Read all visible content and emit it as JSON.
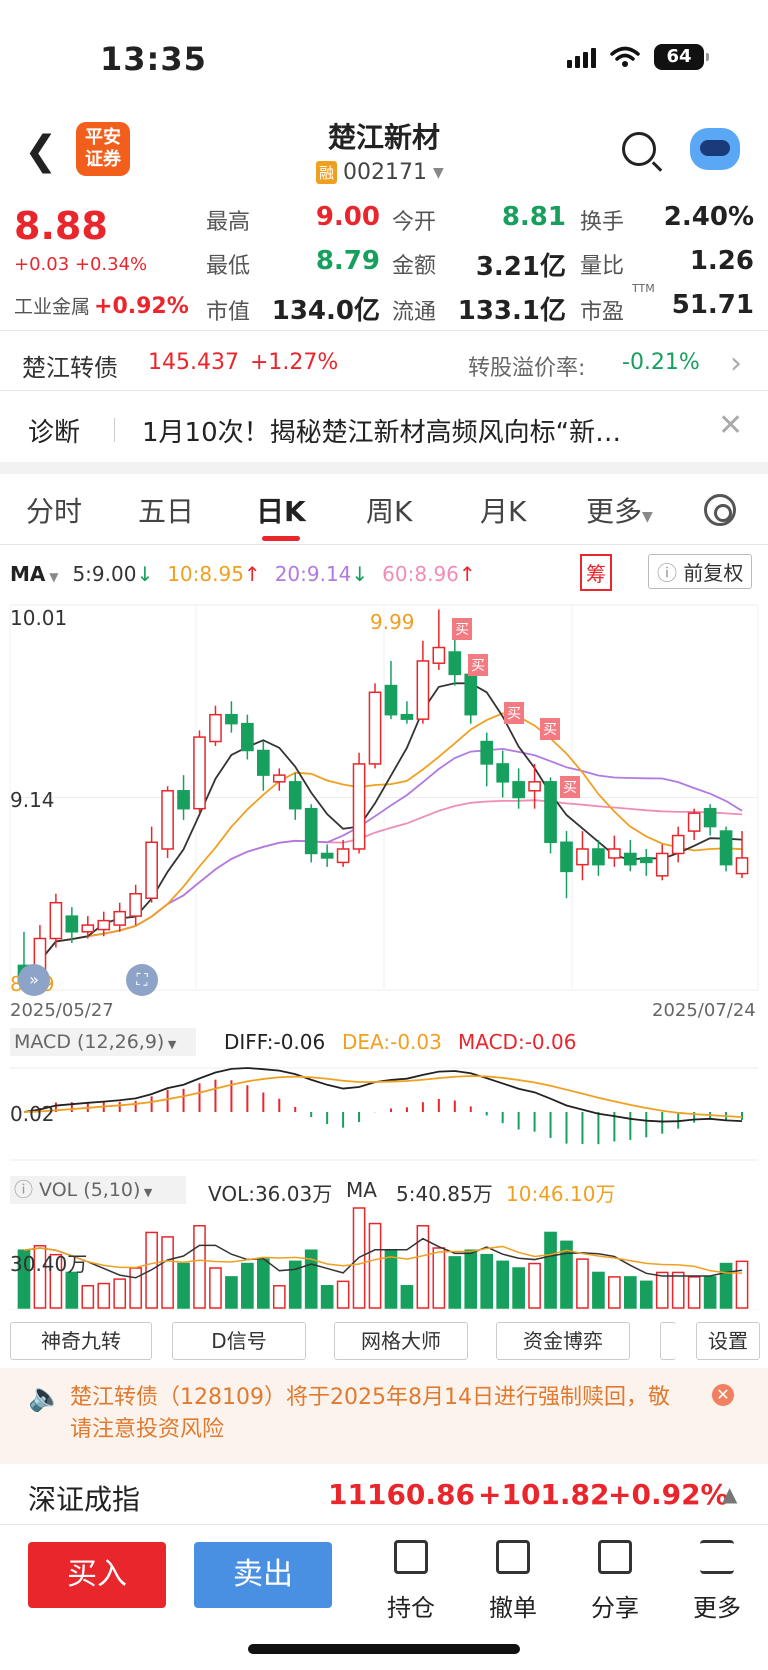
{
  "status": {
    "time": "13:35",
    "battery": "64"
  },
  "header": {
    "logo_line1": "平安",
    "logo_line2": "证券",
    "stock_name": "楚江新材",
    "badge": "融",
    "code": "002171"
  },
  "quote": {
    "price": "8.88",
    "change": "+0.03 +0.34%",
    "industry_label": "工业金属",
    "industry_pct": "+0.92%",
    "high_label": "最高",
    "high": "9.00",
    "open_label": "今开",
    "open": "8.81",
    "turnover_label": "换手",
    "turnover": "2.40%",
    "low_label": "最低",
    "low": "8.79",
    "amount_label": "金额",
    "amount": "3.21亿",
    "vratio_label": "量比",
    "vratio": "1.26",
    "mcap_label": "市值",
    "mcap": "134.0亿",
    "float_label": "流通",
    "float": "133.1亿",
    "pe_label": "市盈",
    "pe_sup": "TTM",
    "pe": "51.71"
  },
  "bond": {
    "name": "楚江转债",
    "price": "145.437",
    "change": "+1.27%",
    "premium_label": "转股溢价率:",
    "premium": "-0.21%"
  },
  "diagnosis": {
    "label": "诊断",
    "text": "1月10次！揭秘楚江新材高频风向标“新…"
  },
  "tabs": [
    "分时",
    "五日",
    "日K",
    "周K",
    "月K",
    "更多"
  ],
  "ma": {
    "label": "MA",
    "ma5": "5:9.00",
    "ma10": "10:8.95",
    "ma20": "20:9.14",
    "ma60": "60:8.96",
    "chou": "筹",
    "fq": "前复权"
  },
  "chart_labels": {
    "top": "10.01",
    "mid": "9.14",
    "bottom": "8.29",
    "high_mark": "9.99",
    "date_start": "2025/05/27",
    "date_end": "2025/07/24",
    "buy": "买"
  },
  "macd": {
    "label": "MACD (12,26,9)",
    "diff": "DIFF:-0.06",
    "dea": "DEA:-0.03",
    "macd": "MACD:-0.06",
    "level": "0.02"
  },
  "vol": {
    "label": "VOL (5,10)",
    "vol": "VOL:36.03万",
    "ma": "MA",
    "ma5": "5:40.85万",
    "ma10": "10:46.10万",
    "level": "30.40万"
  },
  "indicators": [
    "神奇九转",
    "D信号",
    "网格大师",
    "资金博弈",
    "设置"
  ],
  "notice": "楚江转债（128109）将于2025年8月14日进行强制赎回，敬请注意投资风险",
  "index": {
    "name": "深证成指",
    "value": "11160.86",
    "change": "+101.82",
    "pct": "+0.92%"
  },
  "bottom": {
    "buy": "买入",
    "sell": "卖出",
    "items": [
      "持仓",
      "撤单",
      "分享",
      "更多"
    ]
  },
  "colors": {
    "up": "#e8262c",
    "down": "#17a05d",
    "ma5": "#333333",
    "ma10": "#f0a020",
    "ma20": "#b07ae0",
    "ma60": "#f08cb8"
  },
  "chart_data": {
    "type": "candlestick",
    "ylim": [
      8.29,
      10.01
    ],
    "candles": [
      [
        8.4,
        8.32,
        8.55,
        8.29
      ],
      [
        8.33,
        8.52,
        8.58,
        8.3
      ],
      [
        8.52,
        8.68,
        8.72,
        8.48
      ],
      [
        8.62,
        8.55,
        8.66,
        8.5
      ],
      [
        8.55,
        8.58,
        8.62,
        8.52
      ],
      [
        8.56,
        8.6,
        8.64,
        8.53
      ],
      [
        8.58,
        8.64,
        8.68,
        8.55
      ],
      [
        8.62,
        8.72,
        8.76,
        8.58
      ],
      [
        8.7,
        8.95,
        9.02,
        8.68
      ],
      [
        8.92,
        9.18,
        9.2,
        8.88
      ],
      [
        9.18,
        9.1,
        9.25,
        9.05
      ],
      [
        9.1,
        9.42,
        9.45,
        9.08
      ],
      [
        9.4,
        9.52,
        9.56,
        9.38
      ],
      [
        9.52,
        9.48,
        9.58,
        9.44
      ],
      [
        9.48,
        9.36,
        9.52,
        9.32
      ],
      [
        9.36,
        9.25,
        9.4,
        9.18
      ],
      [
        9.22,
        9.25,
        9.28,
        9.18
      ],
      [
        9.22,
        9.1,
        9.26,
        9.05
      ],
      [
        9.1,
        8.9,
        9.12,
        8.86
      ],
      [
        8.9,
        8.88,
        8.94,
        8.84
      ],
      [
        8.86,
        8.92,
        8.96,
        8.84
      ],
      [
        8.92,
        9.3,
        9.35,
        8.9
      ],
      [
        9.3,
        9.62,
        9.66,
        9.28
      ],
      [
        9.65,
        9.52,
        9.76,
        9.5
      ],
      [
        9.52,
        9.5,
        9.58,
        9.48
      ],
      [
        9.5,
        9.76,
        9.85,
        9.48
      ],
      [
        9.75,
        9.82,
        9.99,
        9.72
      ],
      [
        9.8,
        9.7,
        9.88,
        9.65
      ],
      [
        9.7,
        9.52,
        9.74,
        9.48
      ],
      [
        9.4,
        9.3,
        9.44,
        9.2
      ],
      [
        9.3,
        9.22,
        9.36,
        9.15
      ],
      [
        9.22,
        9.15,
        9.28,
        9.1
      ],
      [
        9.18,
        9.22,
        9.3,
        9.1
      ],
      [
        9.22,
        8.95,
        9.24,
        8.9
      ],
      [
        8.95,
        8.82,
        9.0,
        8.7
      ],
      [
        8.85,
        8.92,
        9.0,
        8.78
      ],
      [
        8.92,
        8.85,
        8.96,
        8.8
      ],
      [
        8.88,
        8.92,
        8.98,
        8.84
      ],
      [
        8.9,
        8.85,
        8.96,
        8.82
      ],
      [
        8.88,
        8.86,
        8.92,
        8.8
      ],
      [
        8.8,
        8.9,
        8.94,
        8.78
      ],
      [
        8.9,
        8.98,
        9.02,
        8.86
      ],
      [
        9.0,
        9.08,
        9.1,
        8.96
      ],
      [
        9.1,
        9.02,
        9.12,
        8.98
      ],
      [
        9.0,
        8.85,
        9.02,
        8.82
      ],
      [
        8.81,
        8.88,
        9.0,
        8.79
      ]
    ]
  }
}
